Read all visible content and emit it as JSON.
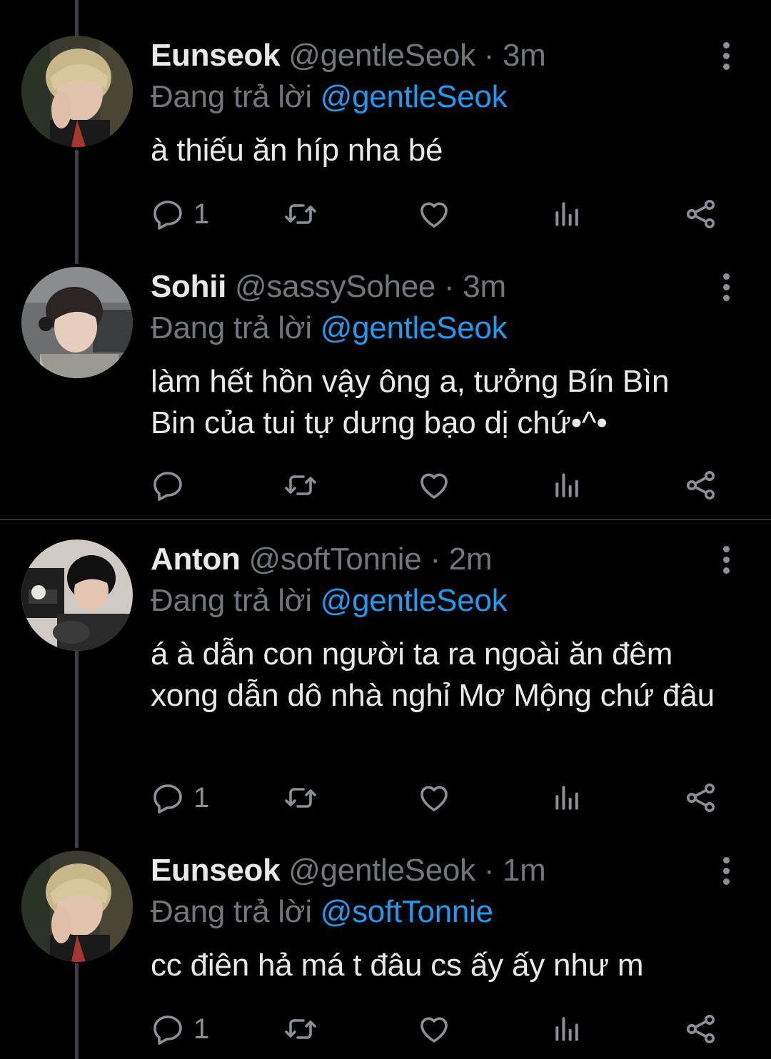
{
  "colors": {
    "background": "#000000",
    "primary_text": "#e7e9ea",
    "secondary_text": "#71767b",
    "link": "#1d9bf0",
    "icon": "#8b9096"
  },
  "reply_prefix": "Đang trả lời",
  "tweets": [
    {
      "display_name": "Eunseok",
      "handle": "@gentleSeok",
      "time": "· 3m",
      "reply_to": "@gentleSeok",
      "text": "à thiếu ăn híp nha bé",
      "reply_count": "1",
      "avatar": "avatar-eunseok"
    },
    {
      "display_name": "Sohii",
      "handle": "@sassySohee",
      "time": "· 3m",
      "reply_to": "@gentleSeok",
      "text": "làm hết hồn vậy ông a, tưởng Bín Bìn Bin của tui tự dưng bạo dị chứ•^•",
      "reply_count": "",
      "avatar": "avatar-sohii"
    },
    {
      "display_name": "Anton",
      "handle": "@softTonnie",
      "time": "· 2m",
      "reply_to": "@gentleSeok",
      "text": "á à dẫn con người ta ra ngoài ăn đêm xong dẫn dô nhà nghỉ Mơ Mộng chứ đâu",
      "reply_count": "1",
      "avatar": "avatar-anton"
    },
    {
      "display_name": "Eunseok",
      "handle": "@gentleSeok",
      "time": "· 1m",
      "reply_to": "@softTonnie",
      "text": "cc điên hả má t đâu cs ấy ấy như m",
      "reply_count": "1",
      "avatar": "avatar-eunseok"
    }
  ],
  "icons": {
    "reply": "reply-icon",
    "retweet": "retweet-icon",
    "like": "like-icon",
    "views": "views-icon",
    "share": "share-icon",
    "more": "more-icon"
  }
}
